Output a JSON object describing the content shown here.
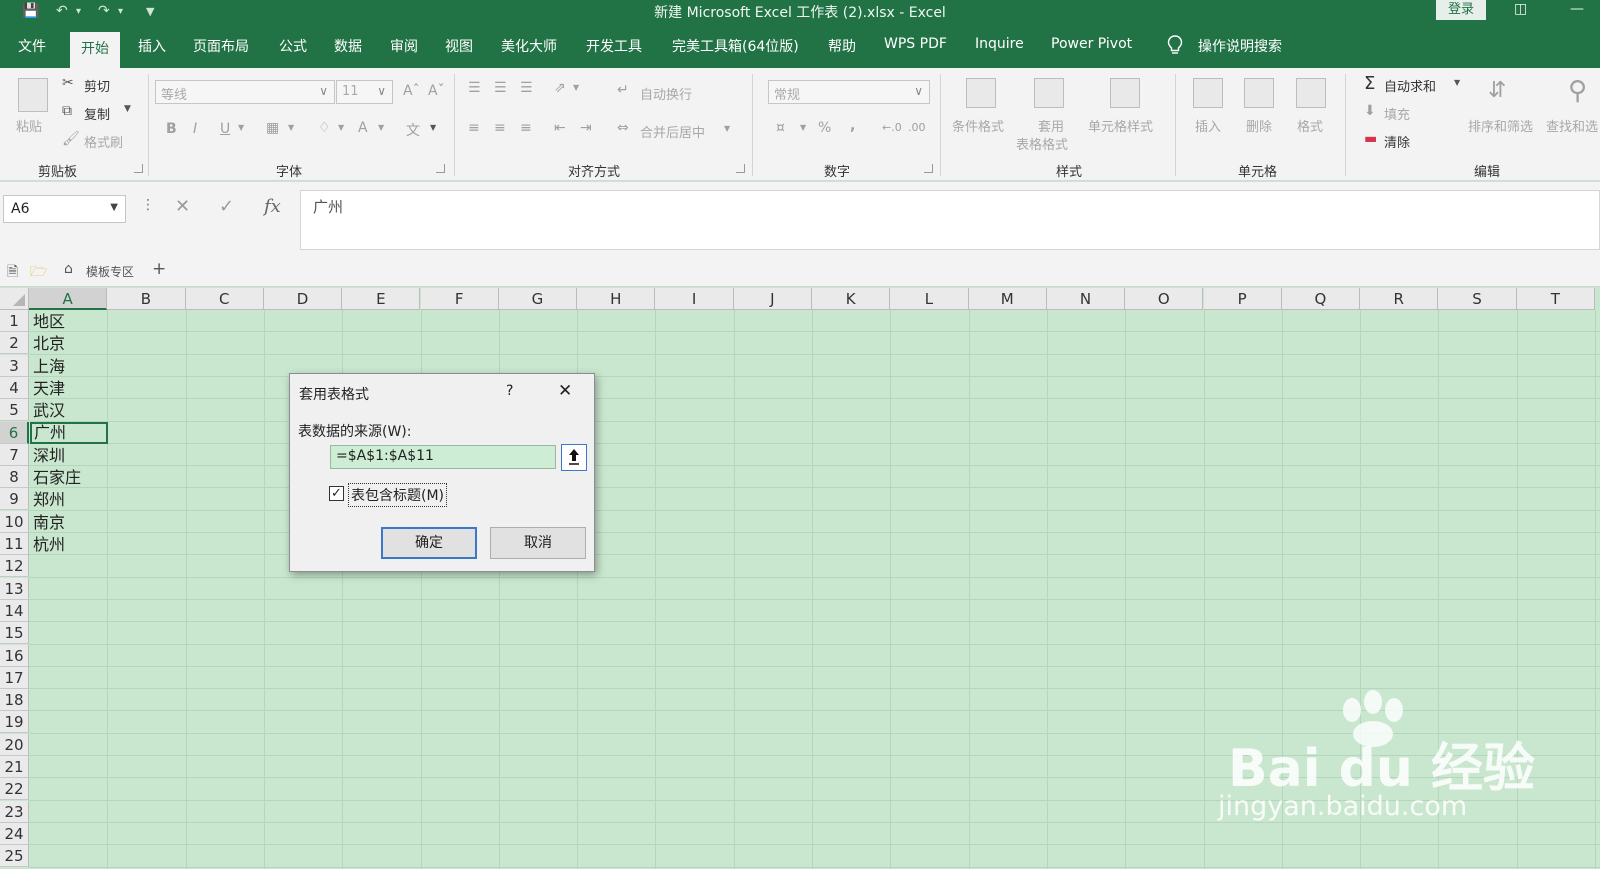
{
  "window": {
    "title": "新建 Microsoft Excel 工作表 (2).xlsx  -  Excel",
    "login_label": "登录"
  },
  "menu": {
    "tabs": [
      "文件",
      "开始",
      "插入",
      "页面布局",
      "公式",
      "数据",
      "审阅",
      "视图",
      "美化大师",
      "开发工具",
      "完美工具箱(64位版)",
      "帮助",
      "WPS PDF",
      "Inquire",
      "Power Pivot"
    ],
    "active_tab": "开始",
    "search_label": "操作说明搜索"
  },
  "ribbon": {
    "clipboard": {
      "paste": "粘贴",
      "cut": "剪切",
      "copy": "复制",
      "format_painter": "格式刷",
      "group": "剪贴板"
    },
    "font": {
      "font_name": "等线",
      "font_size": "11",
      "bold": "B",
      "italic": "I",
      "underline": "U",
      "group": "字体"
    },
    "alignment": {
      "wrap_text": "自动换行",
      "merge_center": "合并后居中",
      "group": "对齐方式"
    },
    "number": {
      "format": "常规",
      "percent": "%",
      "comma": ",",
      "group": "数字"
    },
    "styles": {
      "conditional": "条件格式",
      "table_format_1": "套用",
      "table_format_2": "表格格式",
      "cell_styles": "单元格样式",
      "group": "样式"
    },
    "cells": {
      "insert": "插入",
      "delete": "删除",
      "format": "格式",
      "group": "单元格"
    },
    "editing": {
      "autosum": "自动求和",
      "fill": "填充",
      "clear": "清除",
      "sort_filter": "排序和筛选",
      "find_select": "查找和选",
      "group": "编辑"
    }
  },
  "formula_bar": {
    "name_box": "A6",
    "fx": "fx",
    "content": "广州"
  },
  "doc_tabs": {
    "template_zone": "模板专区",
    "add": "+"
  },
  "sheet": {
    "columns": [
      "A",
      "B",
      "C",
      "D",
      "E",
      "F",
      "G",
      "H",
      "I",
      "J",
      "K",
      "L",
      "M",
      "N",
      "O",
      "P",
      "Q",
      "R",
      "S",
      "T"
    ],
    "rows": [
      "1",
      "2",
      "3",
      "4",
      "5",
      "6",
      "7",
      "8",
      "9",
      "10",
      "11",
      "12",
      "13",
      "14",
      "15",
      "16",
      "17",
      "18",
      "19",
      "20",
      "21",
      "22",
      "23",
      "24",
      "25"
    ],
    "column_a": [
      "地区",
      "北京",
      "上海",
      "天津",
      "武汉",
      "广州",
      "深圳",
      "石家庄",
      "郑州",
      "南京",
      "杭州"
    ],
    "active_cell": "A6"
  },
  "dialog": {
    "title": "套用表格式",
    "help": "?",
    "source_label": "表数据的来源(W):",
    "source_value": "=$A$1:$A$11",
    "has_headers_label": "表包含标题(M)",
    "has_headers_checked": true,
    "ok_label": "确定",
    "cancel_label": "取消"
  },
  "watermark": {
    "brand": "Bai du 经验",
    "url": "jingyan.baidu.com"
  },
  "colors": {
    "excel_green": "#217346",
    "sheet_bg": "#c9e7cf",
    "dialog_input_bg": "#cdeed4"
  }
}
